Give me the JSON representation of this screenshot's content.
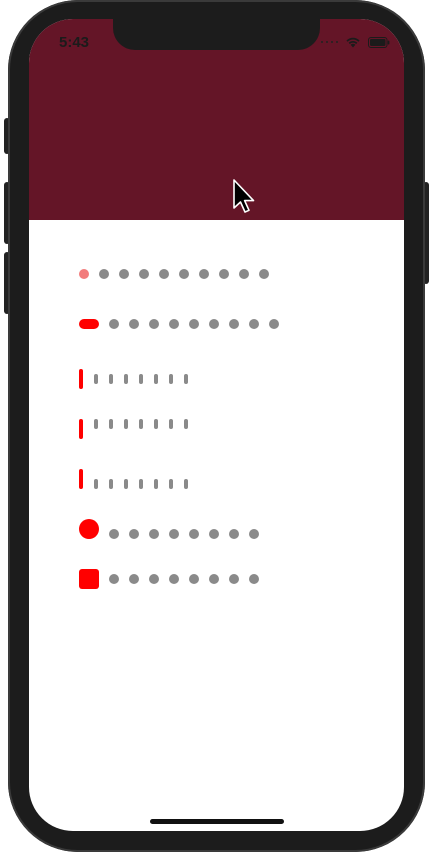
{
  "status_bar": {
    "time": "5:43"
  },
  "colors": {
    "header": "#641527",
    "active": "#ff0000",
    "inactive": "#8a8a8a"
  },
  "indicators": [
    {
      "style": "dot-scale",
      "count": 10,
      "current": 1
    },
    {
      "style": "pill",
      "count": 10,
      "current": 1
    },
    {
      "style": "bar",
      "count": 8,
      "current": 1
    },
    {
      "style": "bar-top",
      "count": 8,
      "current": 1
    },
    {
      "style": "bar-bottom",
      "count": 8,
      "current": 1
    },
    {
      "style": "circle",
      "count": 9,
      "current": 1
    },
    {
      "style": "square",
      "count": 9,
      "current": 1
    }
  ]
}
